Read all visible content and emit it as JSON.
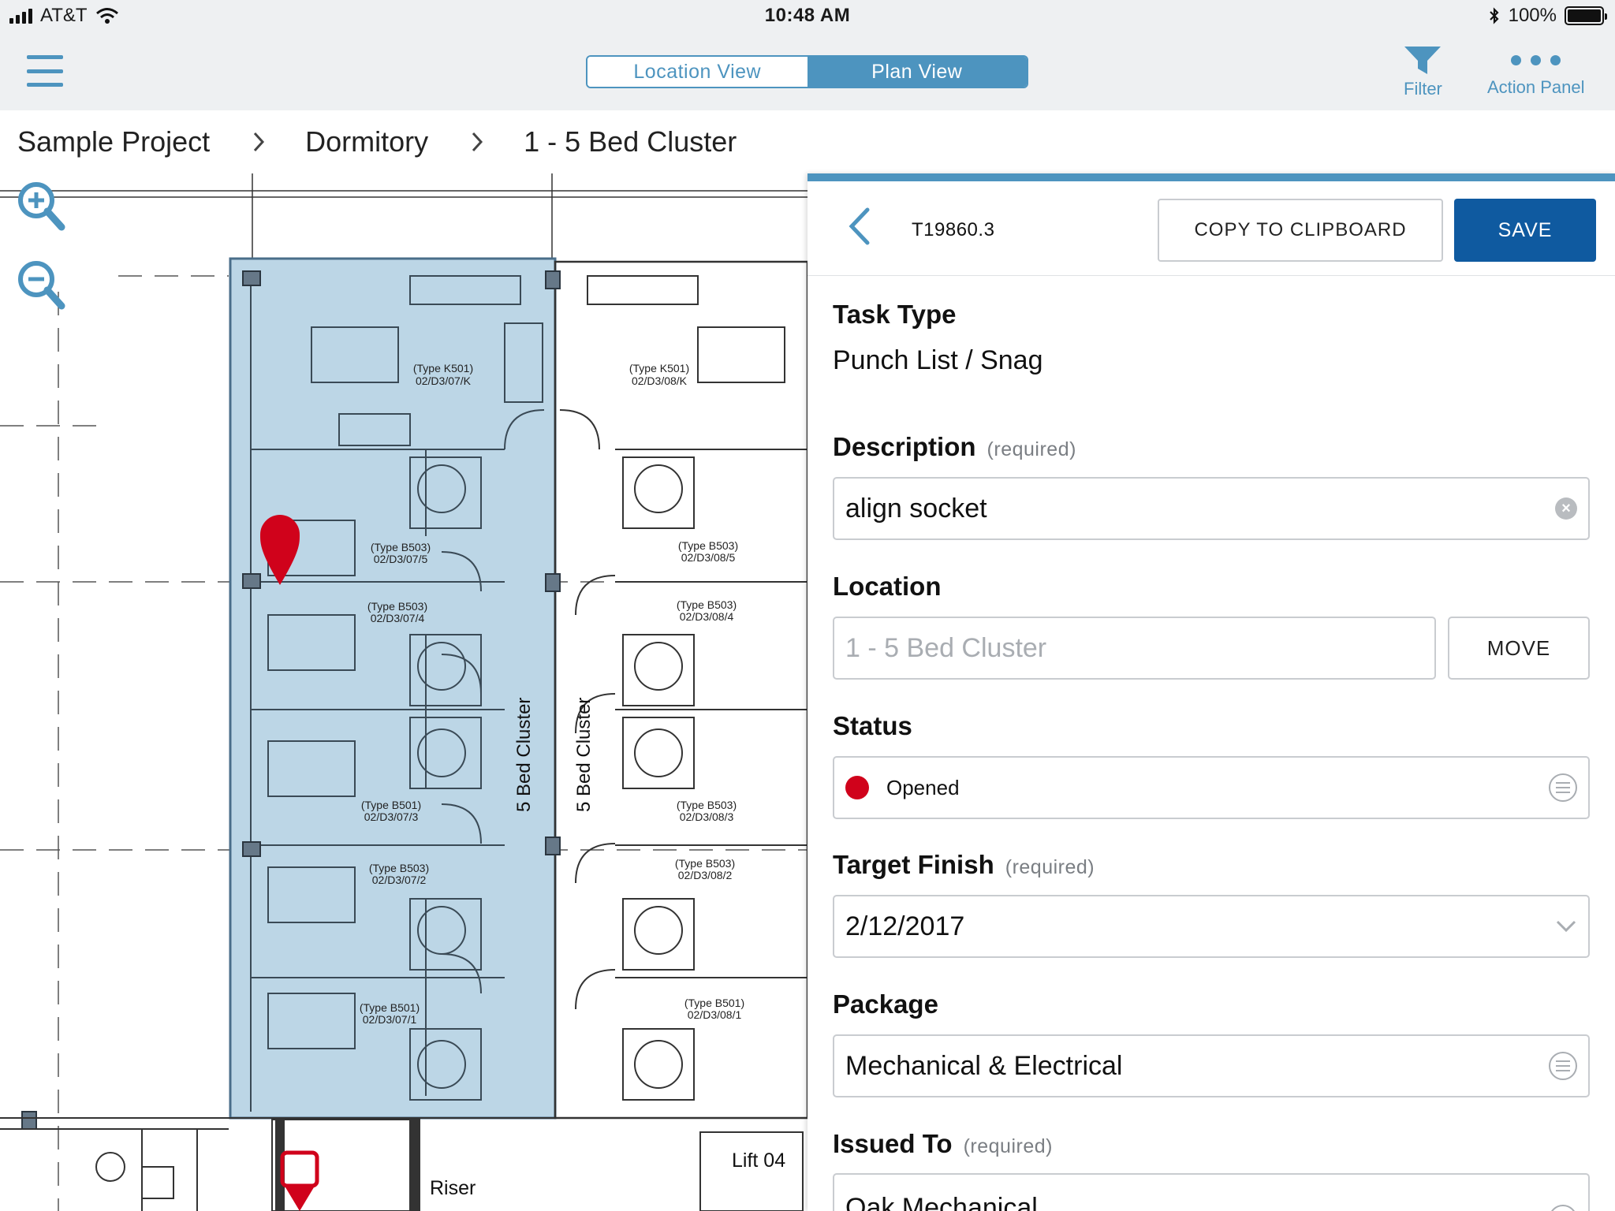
{
  "status_bar": {
    "carrier": "AT&T",
    "time": "10:48 AM",
    "battery": "100%"
  },
  "nav": {
    "segments": [
      {
        "label": "Location View",
        "active": false
      },
      {
        "label": "Plan View",
        "active": true
      }
    ],
    "filter_label": "Filter",
    "action_panel_label": "Action Panel",
    "accent_color": "#4d94bf"
  },
  "breadcrumb": [
    "Sample Project",
    "Dormitory",
    "1 - 5 Bed Cluster"
  ],
  "plan": {
    "cluster_labels": [
      "5 Bed Cluster",
      "5 Bed Cluster"
    ],
    "room_labels": [
      {
        "type": "(Type K501)",
        "code": "02/D3/07/K"
      },
      {
        "type": "(Type K501)",
        "code": "02/D3/08/K"
      },
      {
        "type": "(Type B503)",
        "code": "02/D3/07/5"
      },
      {
        "type": "(Type B503)",
        "code": "02/D3/08/5"
      },
      {
        "type": "(Type B503)",
        "code": "02/D3/07/4"
      },
      {
        "type": "(Type B503)",
        "code": "02/D3/08/4"
      },
      {
        "type": "(Type B501)",
        "code": "02/D3/07/3"
      },
      {
        "type": "(Type B503)",
        "code": "02/D3/08/3"
      },
      {
        "type": "(Type B503)",
        "code": "02/D3/07/2"
      },
      {
        "type": "(Type B503)",
        "code": "02/D3/08/2"
      },
      {
        "type": "(Type B501)",
        "code": "02/D3/07/1"
      },
      {
        "type": "(Type B501)",
        "code": "02/D3/08/1"
      }
    ],
    "riser_label": "Riser",
    "lift_label": "Lift 04",
    "highlight_color": "#bcd6e6",
    "pin_color": "#d0021b"
  },
  "panel": {
    "task_id": "T19860.3",
    "copy_label": "COPY TO CLIPBOARD",
    "save_label": "SAVE",
    "save_color": "#0f5aa0",
    "task_type": {
      "label": "Task Type",
      "value": "Punch List / Snag"
    },
    "description": {
      "label": "Description",
      "required": "(required)",
      "value": "align socket"
    },
    "location": {
      "label": "Location",
      "value": "1 - 5 Bed Cluster",
      "move_label": "MOVE"
    },
    "status": {
      "label": "Status",
      "value": "Opened",
      "color": "#d0021b"
    },
    "target_finish": {
      "label": "Target Finish",
      "required": "(required)",
      "value": "2/12/2017"
    },
    "package": {
      "label": "Package",
      "value": "Mechanical & Electrical"
    },
    "issued_to": {
      "label": "Issued To",
      "required": "(required)",
      "value": "Oak Mechanical"
    }
  }
}
